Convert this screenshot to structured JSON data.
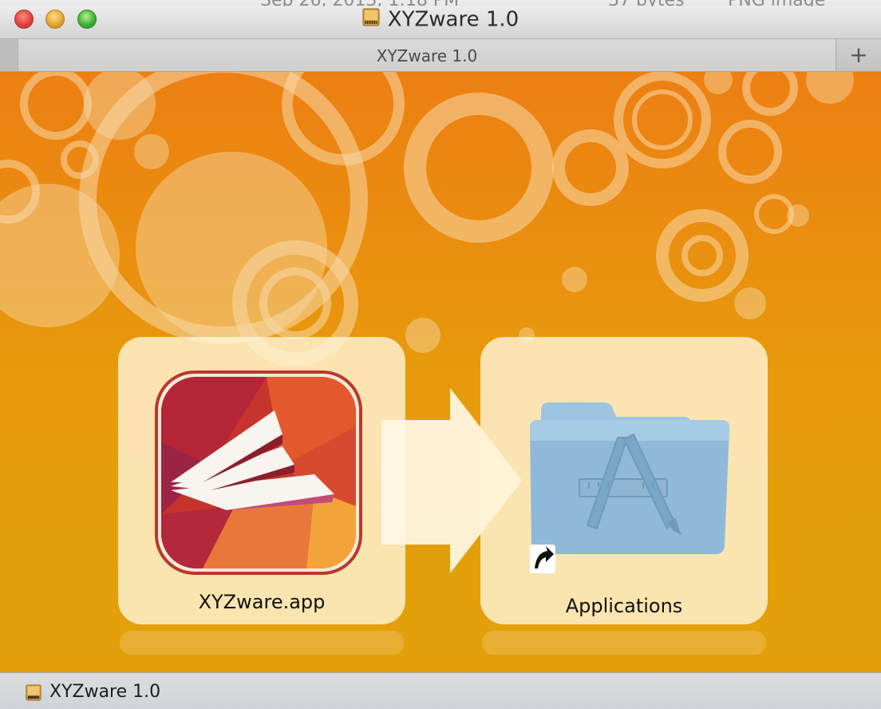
{
  "window": {
    "title": "XYZware 1.0",
    "behind_text": [
      "Sep 26, 2013, 1:18 PM",
      "37 bytes",
      "PNG image"
    ]
  },
  "tabs": {
    "active_label": "XYZware 1.0",
    "add_label": "+"
  },
  "content": {
    "items": [
      {
        "label": "XYZware.app",
        "icon": "xyzware-app-icon"
      },
      {
        "label": "Applications",
        "icon": "applications-folder-icon"
      }
    ],
    "arrow_icon": "right-arrow-icon"
  },
  "statusbar": {
    "label": "XYZware 1.0",
    "icon": "disk-image-icon"
  },
  "colors": {
    "background_top": "#ec7f12",
    "background_bottom": "#e3a00a",
    "tile": "#fff4d6",
    "folder_blue": "#8fb9d9"
  }
}
